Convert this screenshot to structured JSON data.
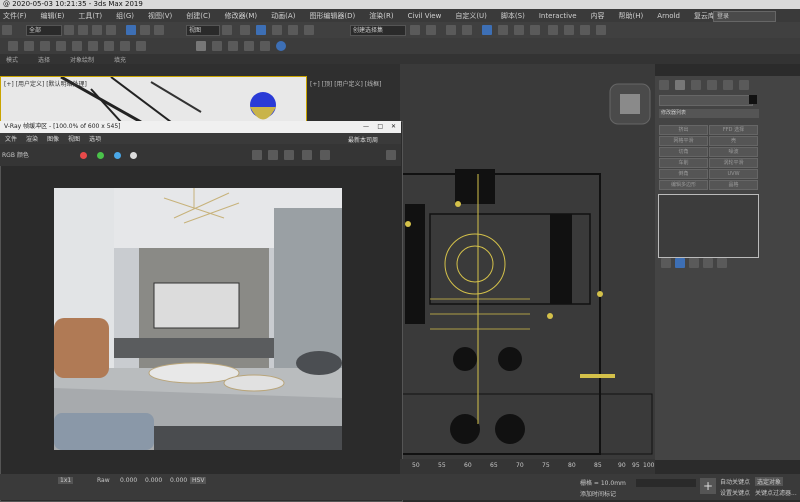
{
  "window": {
    "title": "@ 2020-05-03 10:21:35 - 3ds Max 2019",
    "login": "登录"
  },
  "menu": [
    "文件(F)",
    "编辑(E)",
    "工具(T)",
    "组(G)",
    "视图(V)",
    "创建(C)",
    "修改器(M)",
    "动画(A)",
    "图形编辑器(D)",
    "渲染(R)",
    "Civil View",
    "自定义(U)",
    "脚本(S)",
    "Interactive",
    "内容",
    "帮助(H)",
    "Arnold",
    "复云库"
  ],
  "toolbar": {
    "select_filter": "全部",
    "view_mode": "视图",
    "selection_set": "创建选择集"
  },
  "ribbon": [
    "模式",
    "选择",
    "对象绘制",
    "填充"
  ],
  "viewports": {
    "top_left_label": "[+] [用户定义] [默认明暗处理]",
    "main_label": "[+] [顶] [用户定义] [线框]"
  },
  "vray": {
    "title": "V-Ray 帧缓冲区 - [100.0% of 600 x 545]",
    "menu": [
      "文件",
      "渲染",
      "图像",
      "视图",
      "选项"
    ],
    "channel": "RGB 颜色",
    "history": "最新本司周"
  },
  "command_panel": {
    "dropdown": "修改器列表",
    "buttons": [
      "挤出",
      "FFD 选择",
      "网格平滑",
      "壳",
      "切角",
      "噪波",
      "车削",
      "涡轮平滑",
      "倒角",
      "UVW",
      "编辑多边形",
      "晶格"
    ]
  },
  "timeline": {
    "ticks": [
      "50",
      "55",
      "60",
      "65",
      "70",
      "75",
      "80",
      "85",
      "90",
      "95",
      "100"
    ]
  },
  "status": {
    "rgb_mode": "1x1",
    "raw_label": "Raw",
    "values": [
      "0.000",
      "0.000",
      "0.000"
    ],
    "hsv_label": "HSV",
    "grid": "栅格 = 10.0mm",
    "time_tag": "添加时间标记",
    "auto_key": "自动关键点",
    "selected": "选定对象",
    "set_key": "设置关键点",
    "key_filter": "关键点过滤器..."
  },
  "colors": {
    "vp_border": "#c9a400",
    "blue_dot": "#2a3bd6",
    "yellow_dot": "#c9b44a"
  }
}
